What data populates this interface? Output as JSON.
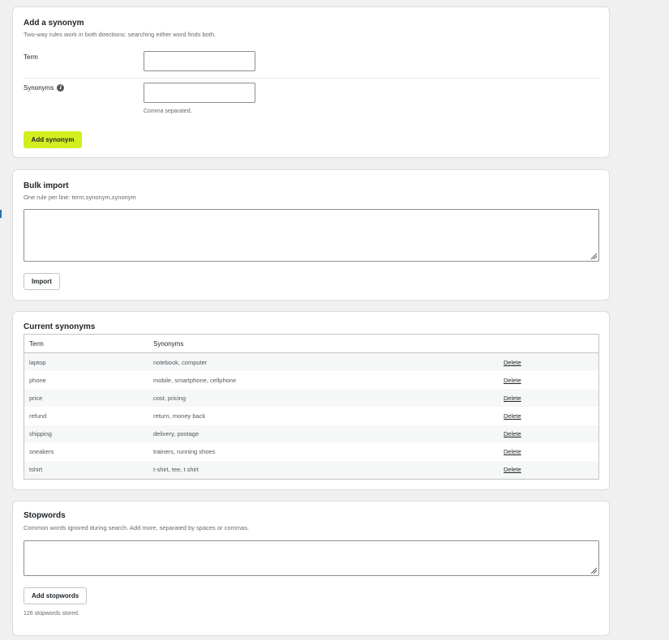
{
  "add_synonym": {
    "title": "Add a synonym",
    "description": "Two-way rules work in both directions: searching either word finds both.",
    "term_label": "Term",
    "term_value": "",
    "synonyms_label": "Synonyms",
    "synonyms_value": "",
    "synonyms_hint": "Comma separated.",
    "submit_label": "Add synonym",
    "accent_color": "#d3ee1f"
  },
  "bulk_import": {
    "title": "Bulk import",
    "description": "One rule per line: term,synonym,synonym",
    "textarea_value": "",
    "button_label": "Import"
  },
  "current_synonyms": {
    "title": "Current synonyms",
    "columns": [
      "Term",
      "Synonyms",
      ""
    ],
    "rows": [
      {
        "term": "laptop",
        "synonyms": "notebook, computer",
        "action": "Delete"
      },
      {
        "term": "phone",
        "synonyms": "mobile, smartphone, cellphone",
        "action": "Delete"
      },
      {
        "term": "price",
        "synonyms": "cost, pricing",
        "action": "Delete"
      },
      {
        "term": "refund",
        "synonyms": "return, money back",
        "action": "Delete"
      },
      {
        "term": "shipping",
        "synonyms": "delivery, postage",
        "action": "Delete"
      },
      {
        "term": "sneakers",
        "synonyms": "trainers, running shoes",
        "action": "Delete"
      },
      {
        "term": "tshirt",
        "synonyms": "t-shirt, tee, t shirt",
        "action": "Delete"
      }
    ]
  },
  "stopwords": {
    "title": "Stopwords",
    "description": "Common words ignored during search. Add more, separated by spaces or commas.",
    "textarea_value": "",
    "button_label": "Add stopwords",
    "count_text": "126 stopwords stored."
  },
  "icons": {
    "info": "info-icon",
    "resize": "resize-grip-icon"
  }
}
